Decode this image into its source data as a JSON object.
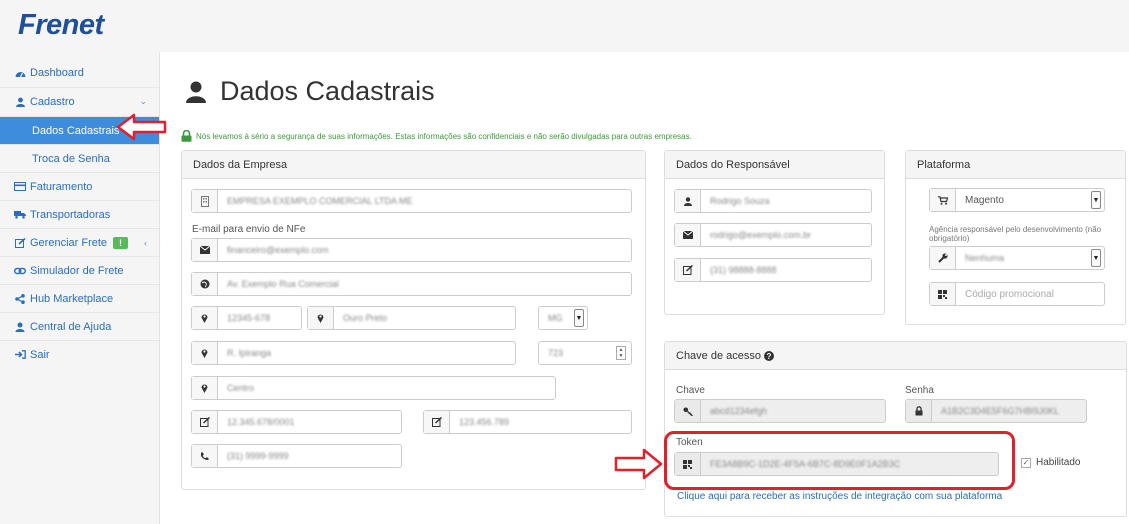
{
  "app": {
    "logo": "Frenet"
  },
  "sidebar": {
    "items": [
      {
        "label": "Dashboard",
        "icon": "dashboard-icon"
      },
      {
        "label": "Cadastro",
        "icon": "user-icon"
      },
      {
        "label": "Dados Cadastrais"
      },
      {
        "label": "Troca de Senha"
      },
      {
        "label": "Faturamento",
        "icon": "credit-card-icon"
      },
      {
        "label": "Transportadoras",
        "icon": "truck-icon"
      },
      {
        "label": "Gerenciar Frete",
        "icon": "edit-icon",
        "badge": "!"
      },
      {
        "label": "Simulador de Frete",
        "icon": "link-icon"
      },
      {
        "label": "Hub Marketplace",
        "icon": "share-icon"
      },
      {
        "label": "Central de Ajuda",
        "icon": "support-icon"
      },
      {
        "label": "Sair",
        "icon": "sign-out-icon"
      }
    ]
  },
  "page": {
    "title": "Dados Cadastrais",
    "notice": "Nós levamos à sério a segurança de suas informações. Estas informações são confidenciais e não serão divulgadas para outras empresas."
  },
  "empresa": {
    "heading": "Dados da Empresa",
    "razao_social": "EMPRESA EXEMPLO COMERCIAL LTDA ME",
    "email_label": "E-mail para envio de NFe",
    "email": "financeiro@exemplo.com",
    "endereco": "Av. Exemplo Rua Comercial",
    "cep": "12345-678",
    "cidade": "Ouro Preto",
    "uf": "MG",
    "rua": "R. Ipiranga",
    "numero": "723",
    "bairro": "Centro",
    "cnpj": "12.345.678/0001",
    "inscricao": "123.456.789",
    "telefone": "(31) 9999-9999"
  },
  "responsavel": {
    "heading": "Dados do Responsável",
    "nome": "Rodrigo Souza",
    "email": "rodrigo@exemplo.com.br",
    "telefone": "(31) 98888-8888"
  },
  "plataforma": {
    "heading": "Plataforma",
    "selected": "Magento",
    "agencia_label": "Agência responsável pelo desenvolvimento (não obrigatório)",
    "agencia_selected": "Nenhuma",
    "promo_placeholder": "Código promocional"
  },
  "chave": {
    "heading": "Chave de acesso",
    "chave_label": "Chave",
    "chave_value": "abcd1234efgh",
    "senha_label": "Senha",
    "senha_value": "A1B2C3D4E5F6G7H8I9J0KL",
    "token_label": "Token",
    "token_value": "FE3A8B9C-1D2E-4F5A-6B7C-8D9E0F1A2B3C",
    "habilitado_label": "Habilitado",
    "link": "Clique aqui para receber as instruções de integração com sua plataforma"
  },
  "colors": {
    "brand": "#1f4e9b",
    "link": "#2a6ebc",
    "active_nav": "#3e8ddc",
    "notice_green": "#3c9a3c",
    "annotation_red": "#e0202a",
    "badge_green": "#5cb85c"
  }
}
